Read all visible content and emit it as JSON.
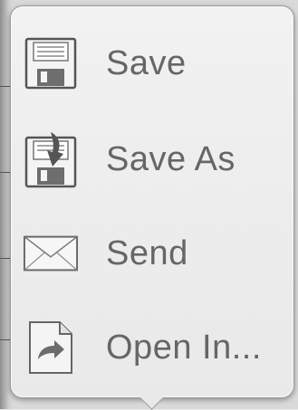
{
  "menu": {
    "items": [
      {
        "label": "Save",
        "icon": "floppy-disk-icon"
      },
      {
        "label": "Save As",
        "icon": "save-as-icon"
      },
      {
        "label": "Send",
        "icon": "envelope-icon"
      },
      {
        "label": "Open In...",
        "icon": "open-in-icon"
      }
    ]
  },
  "colors": {
    "popover_bg": "#ededed",
    "label_text": "#666666",
    "icon_stroke": "#555555"
  }
}
